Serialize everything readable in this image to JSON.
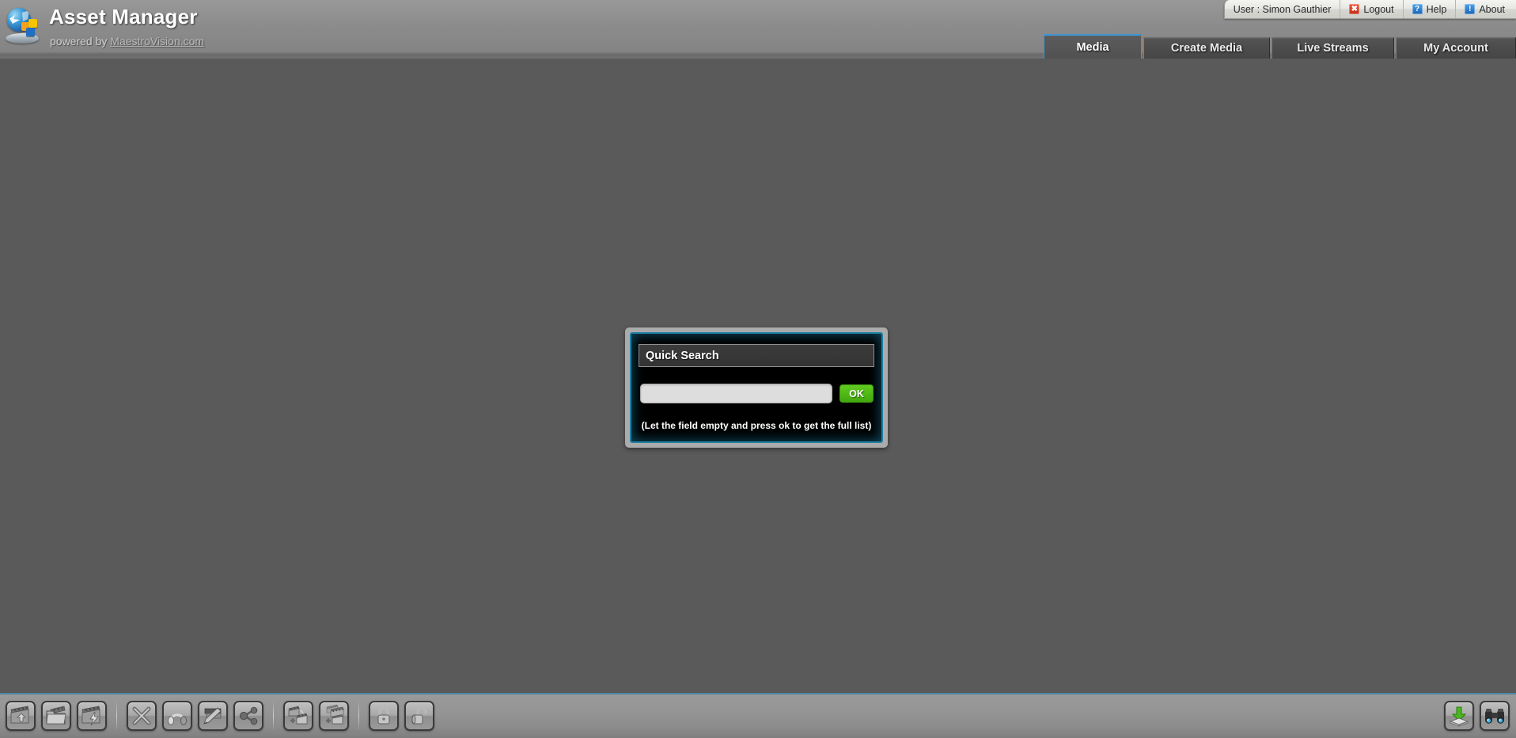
{
  "app": {
    "title": "Asset Manager",
    "powered_prefix": "powered by ",
    "powered_link": "MaestroVision.com",
    "logo_icon": "globe-puzzle-icon"
  },
  "userbar": {
    "user_label": "User : Simon Gauthier",
    "items": [
      {
        "label": "Logout",
        "icon": "red-x-icon"
      },
      {
        "label": "Help",
        "icon": "blue-question-icon"
      },
      {
        "label": "About",
        "icon": "blue-exclamation-icon"
      }
    ],
    "logout_glyph": "✖",
    "help_glyph": "?",
    "about_glyph": "!"
  },
  "nav": {
    "tabs": [
      {
        "label": "Media",
        "active": true
      },
      {
        "label": "Create Media",
        "active": false
      },
      {
        "label": "Live Streams",
        "active": false
      },
      {
        "label": "My Account",
        "active": false
      }
    ],
    "active_accent": "#3c96d4"
  },
  "dialog": {
    "title": "Quick Search",
    "input_value": "",
    "input_placeholder": "",
    "ok_label": "OK",
    "hint": "(Let the field empty and press ok to get the full list)",
    "border_color": "#1f7fa3",
    "ok_color": "#4db714"
  },
  "toolbar": {
    "left_buttons": [
      {
        "name": "import-media-button",
        "icon": "clapperboard-up-arrow-icon"
      },
      {
        "name": "open-media-folder-button",
        "icon": "clapperboard-folder-icon"
      },
      {
        "name": "quick-media-button",
        "icon": "clapperboard-lightning-icon"
      },
      {
        "name": "separator-1",
        "icon": "separator"
      },
      {
        "name": "delete-media-button",
        "icon": "x-cross-icon"
      },
      {
        "name": "audio-preview-button",
        "icon": "headphones-icon"
      },
      {
        "name": "edit-metadata-button",
        "icon": "pencil-edit-icon"
      },
      {
        "name": "share-media-button",
        "icon": "share-nodes-icon"
      },
      {
        "name": "separator-2",
        "icon": "separator"
      },
      {
        "name": "add-to-collection-button",
        "icon": "clapperboards-add-icon"
      },
      {
        "name": "batch-collection-button",
        "icon": "clapperboards-stack-add-icon"
      },
      {
        "name": "separator-3",
        "icon": "separator"
      },
      {
        "name": "lock-media-button",
        "icon": "lock-closed-icon"
      },
      {
        "name": "unlock-media-button",
        "icon": "lock-open-icon"
      }
    ],
    "right_buttons": [
      {
        "name": "download-media-button",
        "icon": "green-download-arrow-icon"
      },
      {
        "name": "search-media-button",
        "icon": "binoculars-icon"
      }
    ]
  },
  "colors": {
    "header_bg": "#8a8a8a",
    "main_bg": "#5a5a5a",
    "toolbar_bg": "#949494",
    "rule": "#4e86a5"
  }
}
